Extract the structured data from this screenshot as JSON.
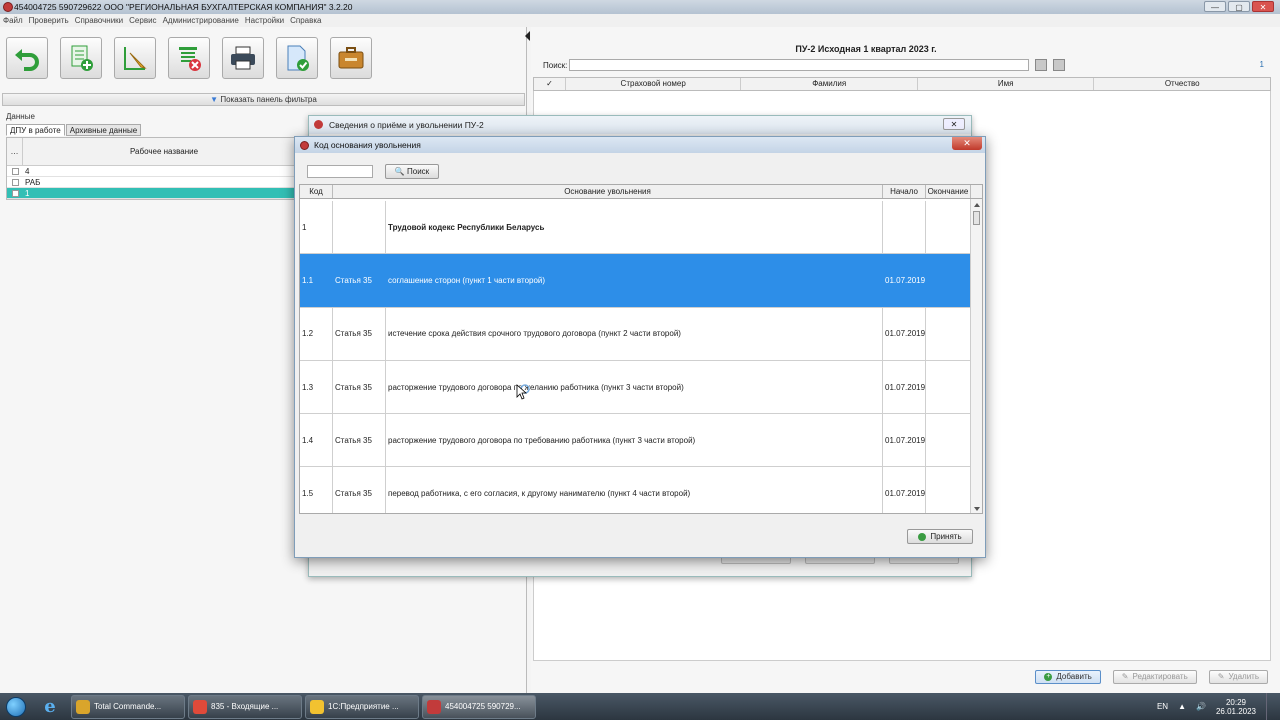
{
  "window": {
    "title": "454004725 590729622 ООО \"РЕГИОНАЛЬНАЯ БУХГАЛТЕРСКАЯ КОМПАНИЯ\" 3.2.20",
    "controls": {
      "minimize": "—",
      "maximize": "▢",
      "close": "✕"
    }
  },
  "menu": [
    "Файл",
    "Проверить",
    "Справочники",
    "Сервис",
    "Администрирование",
    "Настройки",
    "Справка"
  ],
  "toolbar": {
    "icons": [
      "back-arrow-icon",
      "add-document-icon",
      "edit-document-icon",
      "delete-document-icon",
      "printer-icon",
      "check-document-icon",
      "briefcase-icon"
    ]
  },
  "left": {
    "filter_button": "Показать панель фильтра",
    "section_label": "Данные",
    "tabs": [
      "ДПУ в работе",
      "Архивные данные"
    ],
    "table": {
      "select_col": "…",
      "name_col": "Рабочее название",
      "rows": [
        "4",
        "РАБ",
        "1"
      ]
    }
  },
  "right": {
    "heading": "ПУ-2 Исходная 1 квартал 2023 г.",
    "search_label": "Поиск:",
    "count": "1",
    "columns": [
      "✓",
      "Страховой номер",
      "Фамилия",
      "Имя",
      "Отчество"
    ],
    "buttons": {
      "add": "Добавить",
      "edit": "Редактировать",
      "delete": "Удалить"
    }
  },
  "bg_dialog": {
    "title": "Сведения о приёме и увольнении ПУ-2",
    "close": "✕"
  },
  "dialog": {
    "title": "Код основания увольнения",
    "close": "✕",
    "find_button": "Поиск",
    "columns": {
      "code": "Код",
      "reason": "Основание увольнения",
      "start": "Начало",
      "end": "Окончание"
    },
    "rows": [
      {
        "code": "1",
        "article": "",
        "reason": "Трудовой кодекс Республики Беларусь",
        "start": "",
        "end": ""
      },
      {
        "code": "1.1",
        "article": "Статья 35",
        "reason": "соглашение сторон (пункт 1 части второй)",
        "start": "01.07.2019",
        "end": ""
      },
      {
        "code": "1.2",
        "article": "Статья 35",
        "reason": "истечение срока действия срочного трудового договора (пункт 2 части второй)",
        "start": "01.07.2019",
        "end": ""
      },
      {
        "code": "1.3",
        "article": "Статья 35",
        "reason": "расторжение трудового договора по желанию работника (пункт 3 части второй)",
        "start": "01.07.2019",
        "end": ""
      },
      {
        "code": "1.4",
        "article": "Статья 35",
        "reason": "расторжение трудового договора по требованию работника (пункт 3 части второй)",
        "start": "01.07.2019",
        "end": ""
      },
      {
        "code": "1.5",
        "article": "Статья 35",
        "reason": "перевод работника, с его согласия, к другому нанимателю (пункт 4 части второй)",
        "start": "01.07.2019",
        "end": ""
      }
    ],
    "accept_button": "Принять"
  },
  "taskbar": {
    "tasks": [
      {
        "label": "Total Commande...",
        "color": "#d9a52b"
      },
      {
        "label": "835 - Входящие ...",
        "color": "#e04a3a"
      },
      {
        "label": "1С:Предприятие ...",
        "color": "#f2c230"
      },
      {
        "label": "454004725 590729...",
        "color": "#c23b3b"
      }
    ],
    "lang": "EN",
    "time": "20:29",
    "date": "26.01.2023"
  }
}
